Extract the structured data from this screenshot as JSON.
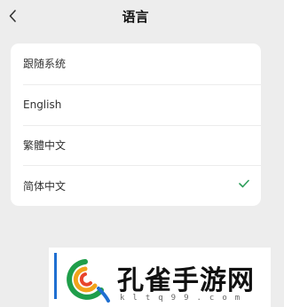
{
  "header": {
    "title": "语言",
    "back_icon": "chevron-left-icon"
  },
  "languages": {
    "items": [
      {
        "label": "跟随系统",
        "selected": false
      },
      {
        "label": "English",
        "selected": false
      },
      {
        "label": "繁體中文",
        "selected": false
      },
      {
        "label": "简体中文",
        "selected": true
      }
    ],
    "check_icon": "checkmark-icon",
    "check_color": "#2e9e5b"
  },
  "watermark": {
    "name": "孔雀手游网",
    "url": "kltq99.com"
  }
}
